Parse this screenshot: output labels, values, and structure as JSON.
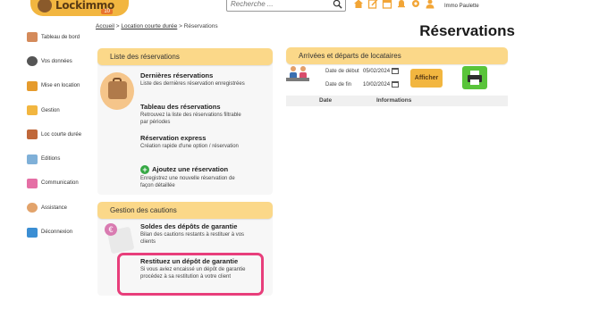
{
  "brand": {
    "logo_text": "Lockimmo",
    "logo_badge": "10"
  },
  "search": {
    "placeholder": "Recherche ..."
  },
  "top_icons": [
    "home-icon",
    "edit-icon",
    "calendar-icon",
    "bell-icon",
    "gear-icon",
    "user-icon"
  ],
  "user": {
    "name": "Immo Paulette"
  },
  "sidebar": {
    "items": [
      {
        "label": "Tableau de bord",
        "icon": "dashboard-icon",
        "color": "#d48a5a"
      },
      {
        "label": "Vos données",
        "icon": "data-icon",
        "color": "#555555"
      },
      {
        "label": "Mise en location",
        "icon": "house-icon",
        "color": "#e59b2d"
      },
      {
        "label": "Gestion",
        "icon": "gestion-icon",
        "color": "#f2b640"
      },
      {
        "label": "Loc courte durée",
        "icon": "suitcase-icon",
        "color": "#c0683a"
      },
      {
        "label": "Editions",
        "icon": "editions-icon",
        "color": "#7fb0d8"
      },
      {
        "label": "Communication",
        "icon": "communication-icon",
        "color": "#e56fa5"
      },
      {
        "label": "Assistance",
        "icon": "assistance-icon",
        "color": "#e2a36b"
      },
      {
        "label": "Déconnexion",
        "icon": "logout-icon",
        "color": "#3b8ed3"
      }
    ]
  },
  "breadcrumb": {
    "home": "Accueil",
    "sep": " > ",
    "section": "Location courte durée",
    "current": "Réservations"
  },
  "page_title": "Réservations",
  "reservations_panel": {
    "title": "Liste des réservations",
    "entries": [
      {
        "title": "Dernières réservations",
        "desc": "Liste des dernières réservation enregistrées"
      },
      {
        "title": "Tableau des réservations",
        "desc": "Retrouvez la liste des réservations filtrable par périodes"
      },
      {
        "title": "Réservation express",
        "desc": "Création rapide d'une option / réservation"
      },
      {
        "title": "Ajoutez une réservation",
        "desc": "Enregistrez une nouvelle réservation de façon détaillée"
      }
    ]
  },
  "cautions_panel": {
    "title": "Gestion des cautions",
    "entries": [
      {
        "title": "Soldes des dépôts de garantie",
        "desc": "Bilan des cautions restants à restituer à vos clients"
      },
      {
        "title": "Restituez un dépôt de garantie",
        "desc": "Si vous aviez encaissé un dépôt de garantie procédez à sa restitution à votre client"
      }
    ]
  },
  "arrivals_panel": {
    "title": "Arrivées et départs de locataires",
    "start_label": "Date de début",
    "start_value": "05/02/2024",
    "end_label": "Date de fin",
    "end_value": "10/02/2024",
    "show_button": "Afficher",
    "columns": [
      "Date",
      "Informations"
    ]
  },
  "colors": {
    "accent": "#fbd889",
    "button": "#f2b640",
    "print": "#59c43a",
    "highlight": "#e83e7b"
  }
}
